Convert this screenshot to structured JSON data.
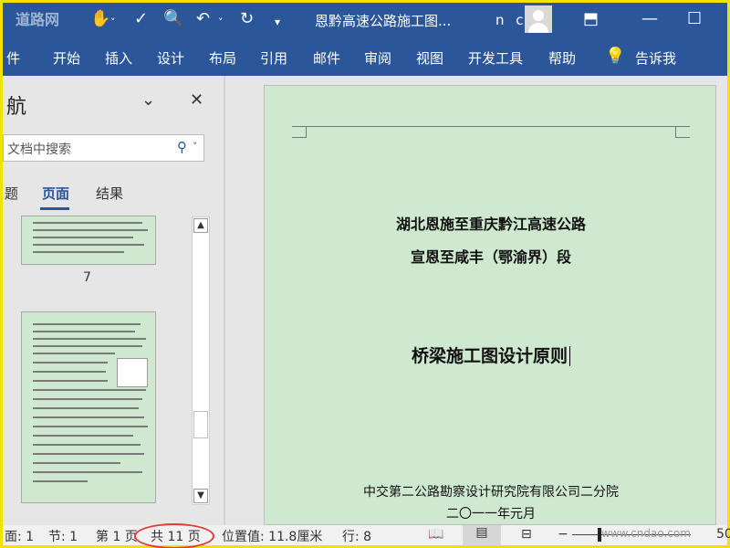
{
  "titlebar": {
    "watermark_left": "道路网",
    "title": "恩黔高速公路施工图...",
    "user": "n c"
  },
  "ribbon": {
    "items": [
      "件",
      "开始",
      "插入",
      "设计",
      "布局",
      "引用",
      "邮件",
      "审阅",
      "视图",
      "开发工具",
      "帮助",
      "告诉我"
    ]
  },
  "nav": {
    "title": "航",
    "search_placeholder": "文档中搜索",
    "tabs": [
      "题",
      "页面",
      "结果"
    ],
    "page_number": "7"
  },
  "document": {
    "header_line1": "湖北恩施至重庆黔江高速公路",
    "header_line2": "宣恩至咸丰（鄂渝界）段",
    "doc_title": "桥梁施工图设计原则",
    "org": "中交第二公路勘察设计研究院有限公司二分院",
    "date": "二〇一一年元月"
  },
  "statusbar": {
    "page_prefix": "面: 1",
    "section": "节: 1",
    "page": "第 1 页",
    "total": "共 11 页",
    "position": "位置值: 11.8厘米",
    "line": "行: 8",
    "watermark": "www.cndao.com",
    "zoom_tail": "50"
  },
  "colors": {
    "ribbon_bg": "#2b579a",
    "page_bg": "#cfe8d0",
    "highlight": "#e53935",
    "frame": "#f3e100"
  },
  "icons": {
    "autosave": "touch-mode-icon",
    "spelling": "spelling-icon",
    "print_preview": "print-preview-icon",
    "undo": "undo-icon",
    "redo": "redo-icon",
    "account": "avatar-icon",
    "share": "ribbon-display-icon",
    "restore": "restore-icon",
    "lightbulb": "lightbulb-icon"
  }
}
